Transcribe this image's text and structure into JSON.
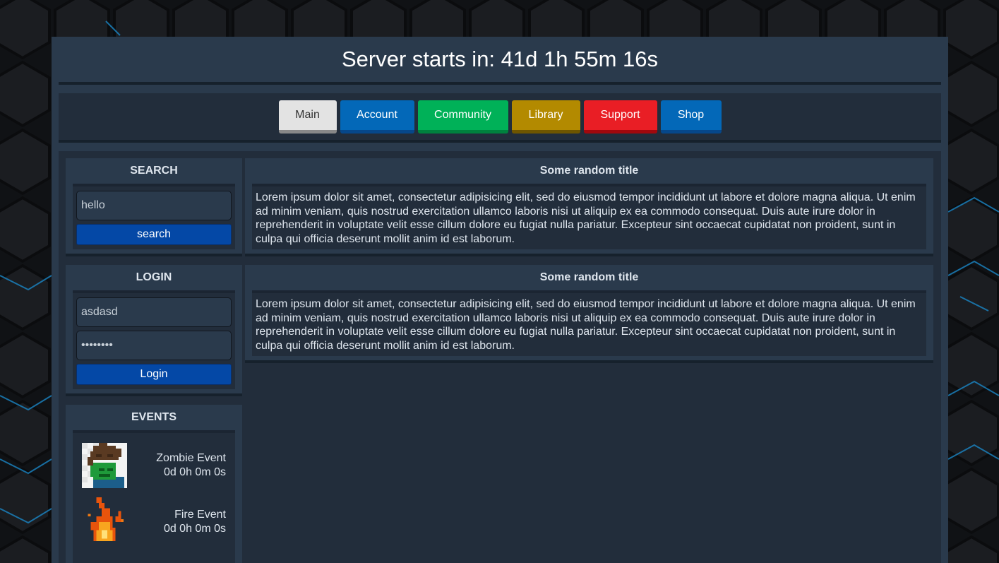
{
  "header": {
    "countdown": "Server starts in: 41d 1h 55m 16s"
  },
  "nav": {
    "items": [
      {
        "label": "Main"
      },
      {
        "label": "Account"
      },
      {
        "label": "Community"
      },
      {
        "label": "Library"
      },
      {
        "label": "Support"
      },
      {
        "label": "Shop"
      }
    ]
  },
  "search": {
    "title": "SEARCH",
    "value": "hello",
    "button": "search"
  },
  "login": {
    "title": "LOGIN",
    "username": "asdasd",
    "password": "••••••••",
    "button": "Login"
  },
  "events": {
    "title": "EVENTS",
    "items": [
      {
        "name": "Zombie Event",
        "time": "0d 0h 0m 0s",
        "icon": "zombie-icon"
      },
      {
        "name": "Fire Event",
        "time": "0d 0h 0m 0s",
        "icon": "fire-icon"
      }
    ]
  },
  "articles": [
    {
      "title": "Some random title",
      "body": "Lorem ipsum dolor sit amet, consectetur adipisicing elit, sed do eiusmod tempor incididunt ut labore et dolore magna aliqua. Ut enim ad minim veniam, quis nostrud exercitation ullamco laboris nisi ut aliquip ex ea commodo consequat. Duis aute irure dolor in reprehenderit in voluptate velit esse cillum dolore eu fugiat nulla pariatur. Excepteur sint occaecat cupidatat non proident, sunt in culpa qui officia deserunt mollit anim id est laborum."
    },
    {
      "title": "Some random title",
      "body": "Lorem ipsum dolor sit amet, consectetur adipisicing elit, sed do eiusmod tempor incididunt ut labore et dolore magna aliqua. Ut enim ad minim veniam, quis nostrud exercitation ullamco laboris nisi ut aliquip ex ea commodo consequat. Duis aute irure dolor in reprehenderit in voluptate velit esse cillum dolore eu fugiat nulla pariatur. Excepteur sint occaecat cupidatat non proident, sunt in culpa qui officia deserunt mollit anim id est laborum."
    }
  ]
}
